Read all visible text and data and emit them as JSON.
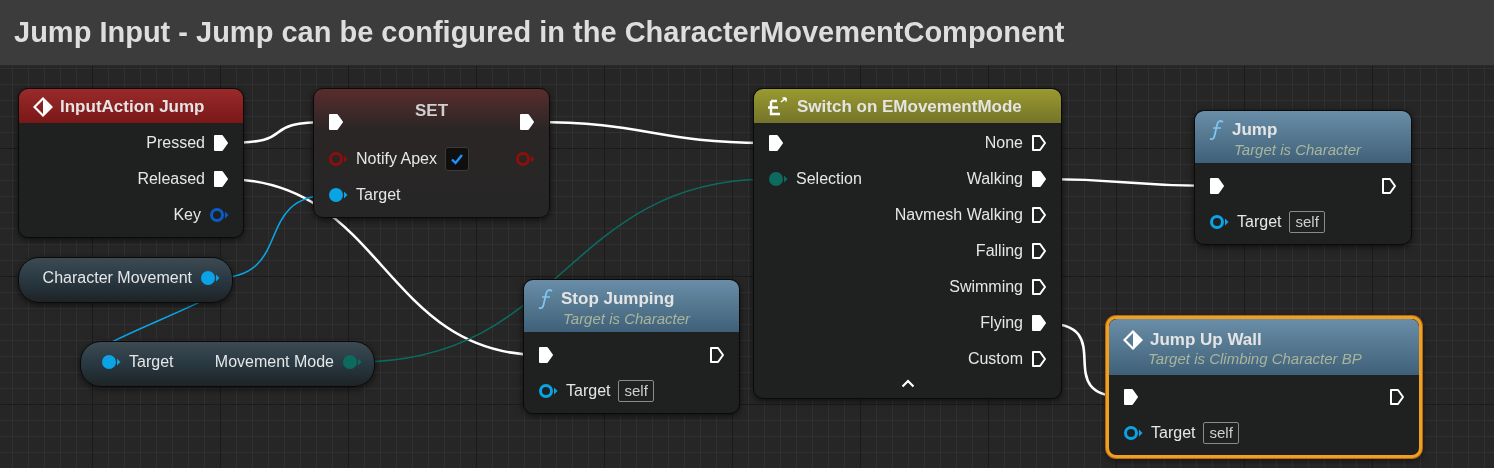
{
  "comment": {
    "title": "Jump Input - Jump can be configured in the CharacterMovementComponent"
  },
  "nodes": [
    {
      "kind": "event",
      "title": "InputAction Jump",
      "selected": false,
      "outputs": [
        {
          "kind": "exec",
          "label": "Pressed",
          "connected": true
        },
        {
          "kind": "exec",
          "label": "Released",
          "connected": true
        },
        {
          "kind": "struct",
          "label": "Key",
          "connected": false
        }
      ]
    },
    {
      "kind": "set",
      "title": "SET",
      "selected": false,
      "inputs": [
        {
          "kind": "exec",
          "connected": true
        },
        {
          "kind": "bool",
          "label": "Notify Apex",
          "connected": false,
          "checked": true
        },
        {
          "kind": "object",
          "label": "Target",
          "connected": true
        }
      ],
      "outputs": [
        {
          "kind": "exec",
          "connected": true
        },
        {
          "kind": "bool",
          "connected": false
        }
      ]
    },
    {
      "kind": "variable",
      "selected": false,
      "outputs": [
        {
          "kind": "object",
          "label": "Character Movement",
          "connected": true
        }
      ]
    },
    {
      "kind": "variable",
      "selected": false,
      "inputs": [
        {
          "kind": "object",
          "label": "Target",
          "connected": true
        }
      ],
      "outputs": [
        {
          "kind": "enum",
          "label": "Movement Mode",
          "connected": true
        }
      ]
    },
    {
      "kind": "function",
      "title": "Stop Jumping",
      "subtitle": "Target is Character",
      "selected": false,
      "inputs": [
        {
          "kind": "exec",
          "connected": true
        },
        {
          "kind": "object",
          "label": "Target",
          "default": "self",
          "connected": false
        }
      ],
      "outputs": [
        {
          "kind": "exec",
          "connected": false
        }
      ]
    },
    {
      "kind": "switch",
      "title": "Switch on EMovementMode",
      "selected": false,
      "expandable": true,
      "inputs": [
        {
          "kind": "exec",
          "connected": true
        },
        {
          "kind": "enum",
          "label": "Selection",
          "connected": true
        }
      ],
      "outputs": [
        {
          "kind": "exec",
          "label": "None",
          "connected": false
        },
        {
          "kind": "exec",
          "label": "Walking",
          "connected": true
        },
        {
          "kind": "exec",
          "label": "Navmesh Walking",
          "connected": false
        },
        {
          "kind": "exec",
          "label": "Falling",
          "connected": false
        },
        {
          "kind": "exec",
          "label": "Swimming",
          "connected": false
        },
        {
          "kind": "exec",
          "label": "Flying",
          "connected": true
        },
        {
          "kind": "exec",
          "label": "Custom",
          "connected": false
        }
      ]
    },
    {
      "kind": "function",
      "title": "Jump",
      "subtitle": "Target is Character",
      "selected": false,
      "inputs": [
        {
          "kind": "exec",
          "connected": true
        },
        {
          "kind": "object",
          "label": "Target",
          "default": "self",
          "connected": false
        }
      ],
      "outputs": [
        {
          "kind": "exec",
          "connected": false
        }
      ]
    },
    {
      "kind": "custom",
      "title": "Jump Up Wall",
      "subtitle": "Target is Climbing Character BP",
      "selected": true,
      "inputs": [
        {
          "kind": "exec",
          "connected": true
        },
        {
          "kind": "object",
          "label": "Target",
          "default": "self",
          "connected": false
        }
      ],
      "outputs": [
        {
          "kind": "exec",
          "connected": false
        }
      ]
    }
  ]
}
